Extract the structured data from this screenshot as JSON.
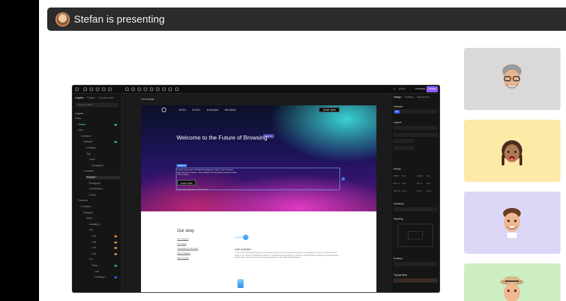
{
  "presenter": {
    "label": "Stefan is presenting"
  },
  "app": {
    "topbar": {
      "zoom": "100%",
      "preview": "Preview",
      "publish": "Publish"
    },
    "left_panel": {
      "tabs": [
        "Layers",
        "Pages",
        "Components"
      ],
      "search_placeholder": "Search Layers",
      "heading": "Layers",
      "layers": [
        "Body",
        "Navbar",
        "Hero",
        "Container",
        "Wrapper",
        "Heading",
        "Tag",
        "Label",
        "Paragraph",
        "Container",
        "Wrapper",
        "Paragraph",
        "Link Buttons",
        "Group",
        "Features",
        "Container",
        "Wrapper",
        "Menu",
        "Heading 3",
        "List",
        "Link",
        "Link",
        "Link",
        "Link",
        "Col",
        "Wrap",
        "Link",
        "Heading 3"
      ]
    },
    "canvas": {
      "page_label": "Homepage",
      "nav": [
        "INTRO",
        "STORY",
        "ROADMAP",
        "REVIEWS"
      ],
      "nav_cta": "START NOW",
      "hero_title": "Welcome to the Future of Browsing",
      "hero_badge": "Beta V1",
      "selection_tag": "Wrapper",
      "hero_desc": "Unlock the power of Artificial Intelligence right in your browser. Experience a smarter, more efficient and amazing experience like never before.",
      "hero_button": "START NOW",
      "hero_small": "Try for Free Sign Up, no credit card",
      "story_title": "Our story",
      "story_links": [
        "Our Journey",
        "Our vision",
        "Innovating AI Our Core",
        "Why it Matters",
        "We Innovate"
      ],
      "story_subhead": "OUR JOURNEY",
      "story_body": "In the ever-evolving landscape of technology, we set out on an ambitious journey to redefine the way we interact with the Internet. Our team of dedicated engineers, researchers and designers, worked to bring Artificial Intelligence and advanced performance, aimed at the web browsing experience for individuals worldwide."
    },
    "right_panel": {
      "tabs": [
        "Design",
        "Settings",
        "Interactions"
      ],
      "sections": [
        "Selector",
        "Layout",
        "Sizing",
        "Overflow",
        "Spacing",
        "Position",
        "Typography"
      ],
      "selector_value": "Div",
      "sizing_labels": [
        "Width",
        "Height",
        "Min W",
        "Min H",
        "Max W",
        "Max H"
      ],
      "sizing_values": [
        "Auto",
        "Auto",
        "Auto",
        "Auto",
        "None",
        "None"
      ]
    }
  },
  "participants": [
    {
      "name": "participant-1",
      "color": "#d9d9d9"
    },
    {
      "name": "participant-2",
      "color": "#fde9a8"
    },
    {
      "name": "participant-3",
      "color": "#ddd7f7"
    },
    {
      "name": "participant-4",
      "color": "#cdeec2"
    }
  ]
}
